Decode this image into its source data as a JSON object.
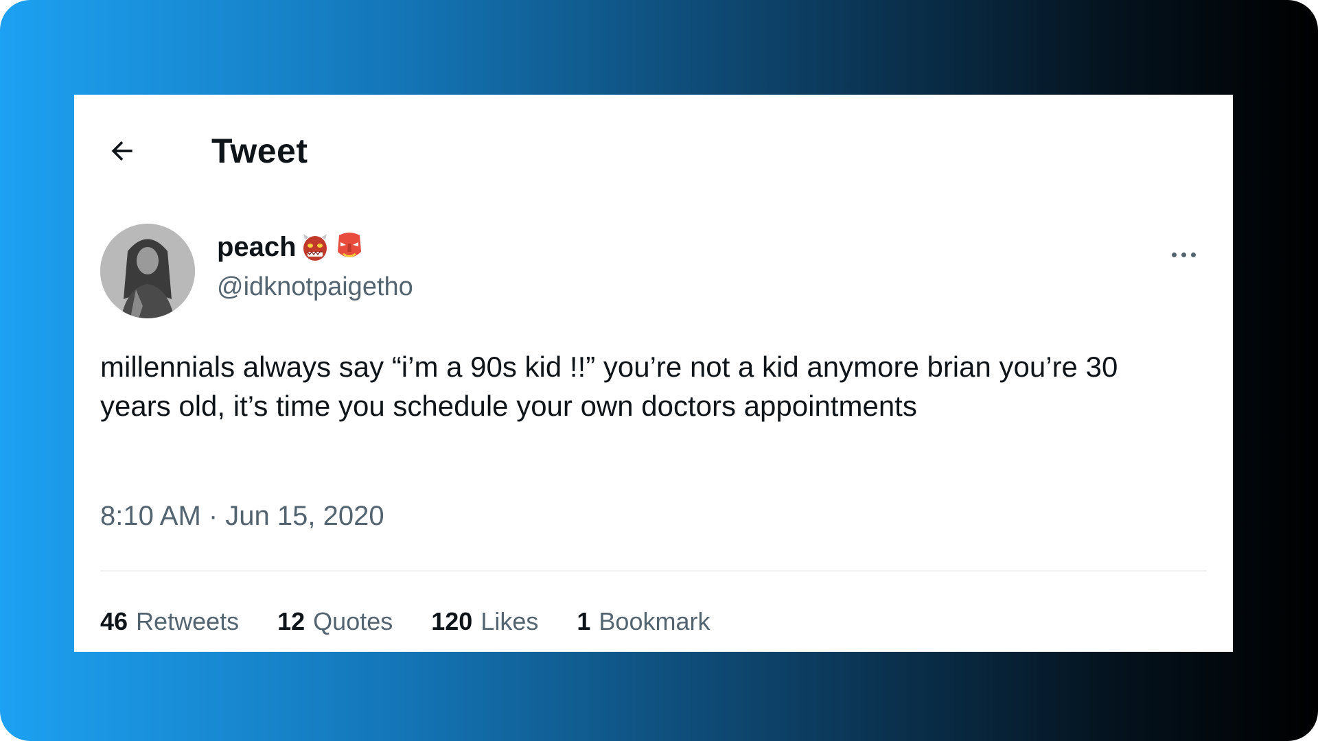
{
  "header": {
    "back_icon": "arrow-left-icon",
    "title": "Tweet"
  },
  "tweet": {
    "author": {
      "display_name": "peach",
      "display_name_emojis": [
        "ogre-emoji",
        "goblin-emoji"
      ],
      "handle": "@idknotpaigetho"
    },
    "more_icon": "ellipsis-icon",
    "text": "millennials always say “i’m a 90s kid !!” you’re not a kid anymore brian you’re 30 years old, it’s time you schedule your own doctors appointments",
    "timestamp": "8:10 AM · Jun 15, 2020"
  },
  "stats": [
    {
      "count": "46",
      "label": "Retweets"
    },
    {
      "count": "12",
      "label": "Quotes"
    },
    {
      "count": "120",
      "label": "Likes"
    },
    {
      "count": "1",
      "label": "Bookmark"
    }
  ],
  "colors": {
    "text_primary": "#0f1419",
    "text_secondary": "#536471",
    "gradient_start": "#1da1f2",
    "gradient_end": "#000000"
  }
}
